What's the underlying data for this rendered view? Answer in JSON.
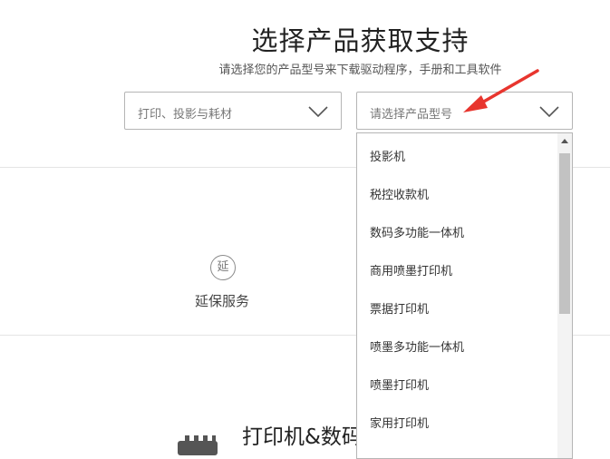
{
  "page": {
    "title": "选择产品获取支持",
    "subtitle": "请选择您的产品型号来下载驱动程序，手册和工具软件"
  },
  "selectors": {
    "category": {
      "value": "打印、投影与耗材",
      "icon": "chevron-down-icon"
    },
    "model": {
      "placeholder": "请选择产品型号",
      "icon": "chevron-down-icon"
    }
  },
  "dropdown": {
    "items": [
      "投影机",
      "税控收款机",
      "数码多功能一体机",
      "商用喷墨打印机",
      "票据打印机",
      "喷墨多功能一体机",
      "喷墨打印机",
      "家用打印机"
    ]
  },
  "services": {
    "extended_warranty": {
      "icon_char": "延",
      "label": "延保服务"
    }
  },
  "section2": {
    "title": "打印机&数码",
    "icon": "printer-icon"
  },
  "annotation": {
    "icon": "red-arrow-icon",
    "color": "#e8352e"
  }
}
